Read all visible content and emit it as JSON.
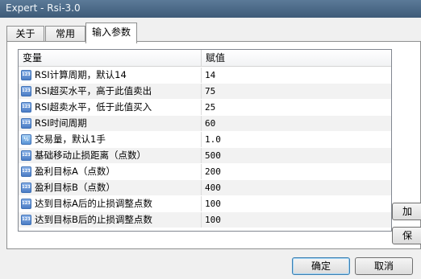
{
  "window": {
    "title": "Expert - Rsi-3.0"
  },
  "tabs": [
    {
      "label": "关于"
    },
    {
      "label": "常用"
    },
    {
      "label": "输入参数"
    }
  ],
  "grid": {
    "columns": [
      "变量",
      "赋值"
    ],
    "rows": [
      {
        "icon": "int-icon",
        "icon_text": "123",
        "name": "RSI计算周期，默认14",
        "value": "14"
      },
      {
        "icon": "int-icon",
        "icon_text": "123",
        "name": "RSI超买水平，高于此值卖出",
        "value": "75"
      },
      {
        "icon": "int-icon",
        "icon_text": "123",
        "name": "RSI超卖水平，低于此值买入",
        "value": "25"
      },
      {
        "icon": "int-icon",
        "icon_text": "123",
        "name": "RSI时间周期",
        "value": "60"
      },
      {
        "icon": "double-icon",
        "icon_text": "½",
        "name": "交易量，默认1手",
        "value": "1.0"
      },
      {
        "icon": "int-icon",
        "icon_text": "123",
        "name": "基础移动止损距离（点数）",
        "value": "500"
      },
      {
        "icon": "int-icon",
        "icon_text": "123",
        "name": "盈利目标A（点数）",
        "value": "200"
      },
      {
        "icon": "int-icon",
        "icon_text": "123",
        "name": "盈利目标B（点数）",
        "value": "400"
      },
      {
        "icon": "int-icon",
        "icon_text": "123",
        "name": "达到目标A后的止损调整点数",
        "value": "100"
      },
      {
        "icon": "int-icon",
        "icon_text": "123",
        "name": "达到目标B后的止损调整点数",
        "value": "100"
      }
    ]
  },
  "side_buttons": [
    {
      "label": "加"
    },
    {
      "label": "保"
    }
  ],
  "buttons": {
    "ok": "确定",
    "cancel": "取消"
  }
}
